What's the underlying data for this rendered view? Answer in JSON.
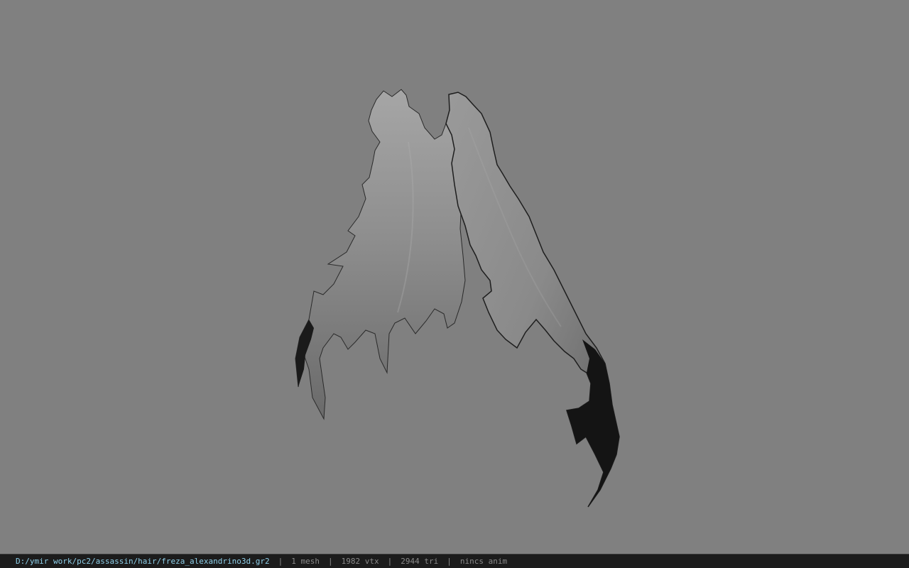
{
  "viewport": {
    "background": "#808080",
    "model_name": "freza_alexandrino3d"
  },
  "status_bar": {
    "file_path": "D:/ymir work/pc2/assassin/hair/freza_alexandrino3d.gr2",
    "separator": "|",
    "mesh_count": "1 mesh",
    "vertex_count": "1982 vtx",
    "triangle_count": "2944 tri",
    "animation": "nincs anim",
    "colors": {
      "path": "#8fd0ea",
      "text": "#8a8a8a",
      "background": "#1c1c1c"
    }
  }
}
